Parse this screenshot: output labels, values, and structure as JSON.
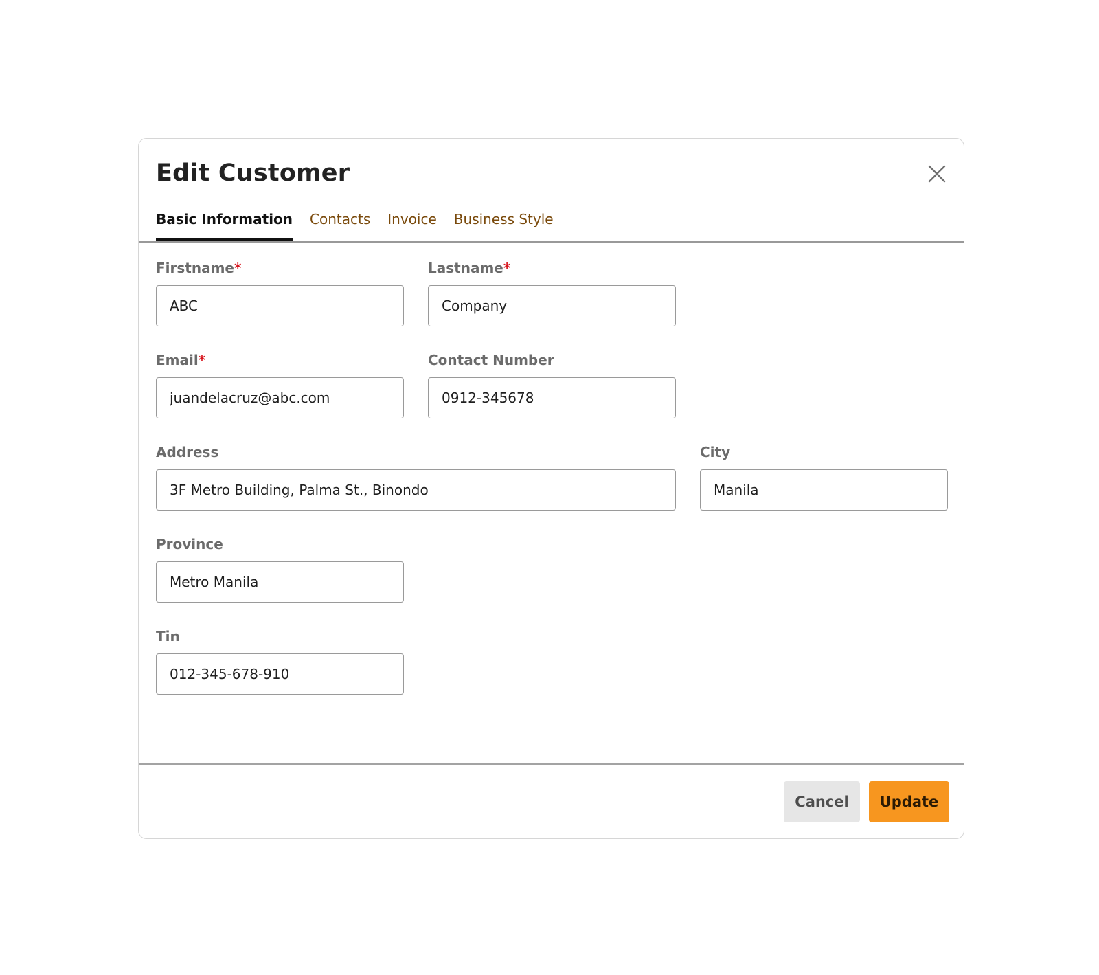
{
  "modal": {
    "title": "Edit Customer",
    "close_icon": "close-icon"
  },
  "tabs": [
    {
      "label": "Basic Information",
      "active": true
    },
    {
      "label": "Contacts",
      "active": false
    },
    {
      "label": "Invoice",
      "active": false
    },
    {
      "label": "Business Style",
      "active": false
    }
  ],
  "form": {
    "firstname": {
      "label": "Firstname",
      "required_mark": "*",
      "value": "ABC"
    },
    "lastname": {
      "label": "Lastname",
      "required_mark": "*",
      "value": "Company"
    },
    "email": {
      "label": "Email",
      "required_mark": "*",
      "value": "juandelacruz@abc.com"
    },
    "contact_number": {
      "label": "Contact Number",
      "value": "0912-345678"
    },
    "address": {
      "label": "Address",
      "value": "3F Metro Building, Palma St., Binondo"
    },
    "city": {
      "label": "City",
      "value": "Manila"
    },
    "province": {
      "label": "Province",
      "value": "Metro Manila"
    },
    "tin": {
      "label": "Tin",
      "value": "012-345-678-910"
    }
  },
  "footer": {
    "cancel_label": "Cancel",
    "update_label": "Update"
  },
  "colors": {
    "accent": "#f7961f",
    "tab_inactive": "#7a4a0c",
    "required": "#d8141c",
    "cancel_bg": "#e6e6e6"
  }
}
